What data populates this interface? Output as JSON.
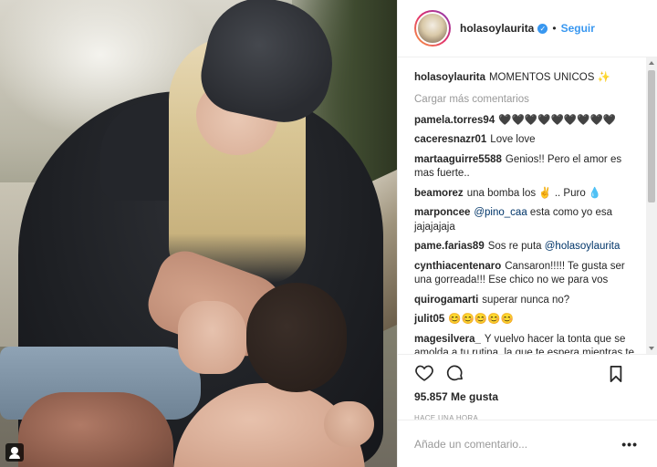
{
  "post": {
    "username": "holasoylaurita",
    "follow_label": "Seguir",
    "caption_text": "MOMENTOS UNICOS ✨",
    "load_more": "Cargar más comentarios",
    "likes": "95.857 Me gusta",
    "time": "HACE UNA HORA",
    "add_comment_placeholder": "Añade un comentario...",
    "more_icon": "•••"
  },
  "comments": [
    {
      "user": "pamela.torres94",
      "text": "🖤🖤🖤🖤🖤🖤🖤🖤🖤",
      "mention": ""
    },
    {
      "user": "caceresnazr01",
      "text": "Love love",
      "mention": ""
    },
    {
      "user": "martaaguirre5588",
      "text": "Genios!! Pero el amor es mas fuerte..",
      "mention": ""
    },
    {
      "user": "beamorez",
      "text": "una bomba los ✌ .. Puro 💧",
      "mention": ""
    },
    {
      "user": "marponcee",
      "text": "esta como yo esa jajajajaja",
      "mention": "@pino_caa"
    },
    {
      "user": "pame.farias89",
      "text": "Sos re puta",
      "mention": "@holasoylaurita"
    },
    {
      "user": "cynthiacentenaro",
      "text": "Cansaron!!!!! Te gusta ser una gorreada!!! Ese chico no we para vos",
      "mention": ""
    },
    {
      "user": "quirogamarti",
      "text": "superar nunca no?",
      "mention": ""
    },
    {
      "user": "julit05",
      "text": "😊😊😊😊😊",
      "mention": ""
    },
    {
      "user": "magesilvera_",
      "text": "Y vuelvo hacer la tonta que se amolda a tu rutina, la que te espera mientras te cocina, que se pone contenta si",
      "mention": ""
    }
  ],
  "colors": {
    "accent": "#3897f0",
    "text": "#262626",
    "muted": "#999999"
  }
}
